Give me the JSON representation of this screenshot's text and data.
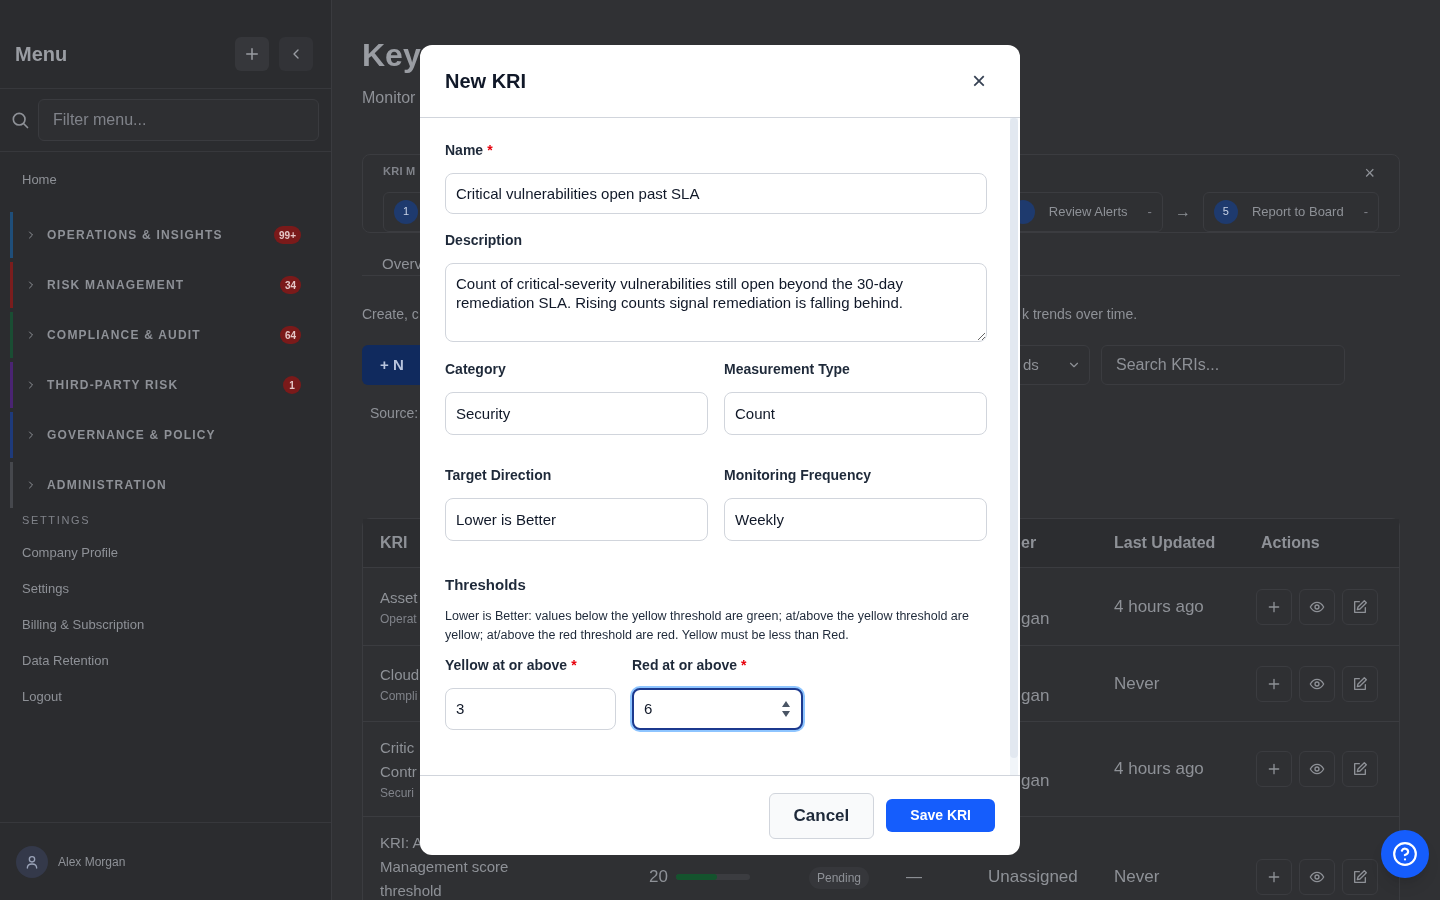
{
  "sidebar": {
    "title": "Menu",
    "filter_placeholder": "Filter menu...",
    "home": "Home",
    "groups": [
      {
        "label": "OPERATIONS & INSIGHTS",
        "badge": "99+",
        "color": "#1f4e79"
      },
      {
        "label": "RISK MANAGEMENT",
        "badge": "34",
        "color": "#7a1d1d"
      },
      {
        "label": "COMPLIANCE & AUDIT",
        "badge": "64",
        "color": "#1a4d33"
      },
      {
        "label": "THIRD-PARTY RISK",
        "badge": "1",
        "color": "#4a2472"
      },
      {
        "label": "GOVERNANCE & POLICY",
        "color": "#1e3a7a"
      },
      {
        "label": "ADMINISTRATION",
        "color": "#46484d"
      }
    ],
    "settings_heading": "SETTINGS",
    "settings_items": [
      "Company Profile",
      "Settings",
      "Billing & Subscription",
      "Data Retention",
      "Logout"
    ],
    "user": "Alex Morgan"
  },
  "main": {
    "title": "Key",
    "subtitle": "Monitor",
    "workflow": {
      "label": "KRI M",
      "close": "×",
      "steps": [
        {
          "number": "1"
        },
        {
          "label": "Review Alerts",
          "status": "-"
        },
        {
          "arrow": "→",
          "number": "5",
          "label": "Report to Board",
          "status": "-"
        }
      ]
    },
    "tab": "Overv",
    "description_left": "Create, c",
    "description_right": "k trends over time.",
    "new_button": "+ N",
    "filter_select": "ds",
    "search_placeholder": "Search KRIs...",
    "source": "Source:",
    "table": {
      "columns": {
        "kri": "KRI",
        "owner": "er",
        "last_updated": "Last Updated",
        "actions": "Actions"
      },
      "rows": [
        {
          "kind": "partial",
          "name_lines": [
            "Asset"
          ],
          "category": "Operat",
          "owner": "gan",
          "last_updated": "4 hours ago"
        },
        {
          "kind": "partial",
          "name_lines": [
            "Cloud"
          ],
          "category": "Compli",
          "owner": "gan",
          "last_updated": "Never"
        },
        {
          "kind": "partial",
          "name_lines": [
            "Critic",
            "Contr"
          ],
          "category": "Securi",
          "owner": "gan",
          "last_updated": "4 hours ago"
        },
        {
          "kind": "full",
          "name_lines": [
            "KRI: A",
            "Management score",
            "threshold"
          ],
          "value": "20",
          "level": 0.55,
          "status": "Pending",
          "trend": "—",
          "owner": "Unassigned",
          "last_updated": "Never"
        }
      ]
    }
  },
  "modal": {
    "title": "New KRI",
    "close": "×",
    "fields": [
      {
        "kind": "input",
        "label": "Name",
        "required_mark": "*",
        "value": "Critical vulnerabilities open past SLA"
      },
      {
        "kind": "textarea",
        "label": "Description",
        "value": "Count of critical-severity vulnerabilities still open beyond the 30-day remediation SLA. Rising counts signal remediation is falling behind."
      }
    ],
    "field_pairs": [
      [
        {
          "label": "Category",
          "value": "Security"
        },
        {
          "label": "Measurement Type",
          "value": "Count"
        }
      ],
      [
        {
          "label": "Target Direction",
          "value": "Lower is Better"
        },
        {
          "label": "Monitoring Frequency",
          "value": "Weekly"
        }
      ]
    ],
    "thresholds": {
      "heading": "Thresholds",
      "help": "Lower is Better: values below the yellow threshold are green; at/above the yellow threshold are yellow; at/above the red threshold are red. Yellow must be less than Red.",
      "inputs": [
        {
          "label": "Yellow at or above",
          "required_mark": "*",
          "value": "3",
          "focused": false
        },
        {
          "label": "Red at or above",
          "required_mark": "*",
          "value": "6",
          "focused": true
        }
      ]
    },
    "buttons": [
      {
        "label": "Cancel",
        "kind": "secondary"
      },
      {
        "label": "Save KRI",
        "kind": "primary"
      }
    ]
  }
}
